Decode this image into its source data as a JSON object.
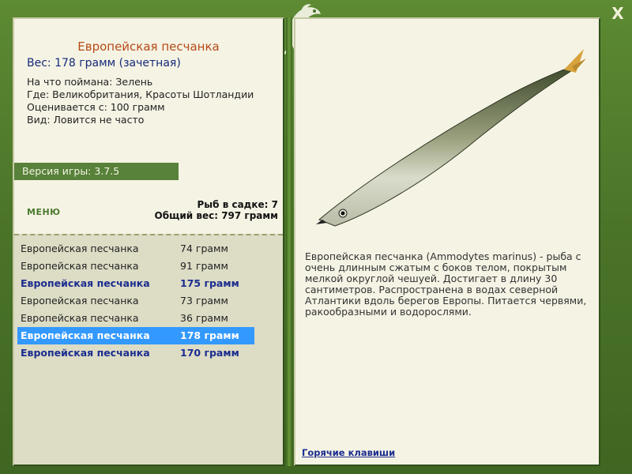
{
  "fish": {
    "title": "Европейская песчанка",
    "weight": "Вес: 178 грамм (зачетная)",
    "caught_on": "На что поймана: Зелень",
    "location": "Где: Великобритания, Красоты Шотландии",
    "valued_from": "Оценивается с: 100 грамм",
    "rarity": "Вид: Ловится не часто",
    "description": "Европейская песчанка (Ammodytes marinus) - рыба с очень длинным сжатым с боков телом, покрытым мелкой округлой чешуей. Достигает в длину 30 сантиметров. Распространена в водах северной Атлантики вдоль берегов Европы. Питается червями, ракообразными и водорослями."
  },
  "version": "Версия игры: 3.7.5",
  "menu_label": "МЕНЮ",
  "stats": {
    "fish_count": "Рыб в садке: 7",
    "total_weight": "Общий вес: 797 грамм"
  },
  "catch_list": [
    {
      "name": "Европейская песчанка",
      "weight": "74 грамм"
    },
    {
      "name": "Европейская песчанка",
      "weight": "91 грамм"
    },
    {
      "name": "Европейская песчанка",
      "weight": "175 грамм"
    },
    {
      "name": "Европейская песчанка",
      "weight": "73 грамм"
    },
    {
      "name": "Европейская песчанка",
      "weight": "36 грамм"
    },
    {
      "name": "Европейская песчанка",
      "weight": "178 грамм"
    },
    {
      "name": "Европейская песчанка",
      "weight": "170 грамм"
    }
  ],
  "hotkeys_label": "Горячие клавиши",
  "close_label": "X",
  "icons": {
    "logo": "fish-logo-icon",
    "close": "close-icon"
  }
}
